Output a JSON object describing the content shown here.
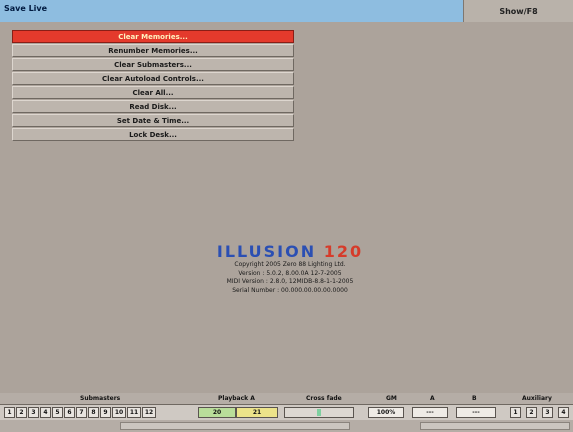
{
  "titlebar": {
    "title": "Save Live",
    "right_label": "Show/F8"
  },
  "menu": {
    "items": [
      {
        "label": "Clear Memories...",
        "active": true
      },
      {
        "label": "Renumber Memories...",
        "active": false
      },
      {
        "label": "Clear Submasters...",
        "active": false
      },
      {
        "label": "Clear Autoload Controls...",
        "active": false
      },
      {
        "label": "Clear All...",
        "active": false
      },
      {
        "label": "Read Disk...",
        "active": false
      },
      {
        "label": "Set Date & Time...",
        "active": false
      },
      {
        "label": "Lock Desk...",
        "active": false
      }
    ]
  },
  "about": {
    "logo_part1": "ILLUSION",
    "logo_part2": "120",
    "copyright": "Copyright 2005 Zero 88 Lighting Ltd.",
    "version": "Version : 5.0.2, 8.00.0A 12-7-2005",
    "midi": "MIDI Version : 2.8.0, 12MIDB-8.8-1-1-2005",
    "serial": "Serial Number : 00.000.00.00.00.0000"
  },
  "status": {
    "submasters": "Submasters",
    "playback": "Playback A",
    "crossfade": "Cross fade",
    "grand_master": "GM",
    "a": "A",
    "b": "B",
    "auxiliary": "Auxiliary"
  },
  "bottombar": {
    "numbers": [
      "1",
      "2",
      "3",
      "4",
      "5",
      "6",
      "7",
      "8",
      "9",
      "10",
      "11",
      "12"
    ],
    "playback_x": "20",
    "playback_y": "21",
    "gm_value": "100%",
    "a_value": "---",
    "b_value": "---",
    "aux": [
      "1",
      "2",
      "3",
      "4"
    ]
  },
  "colors": {
    "titlebar": "#8ebde0",
    "active_item": "#e43a2c",
    "logo_blue": "#2b4fb3",
    "logo_red": "#d63b2a",
    "playback_green": "#b9dd9a",
    "playback_yellow": "#ece38a"
  }
}
